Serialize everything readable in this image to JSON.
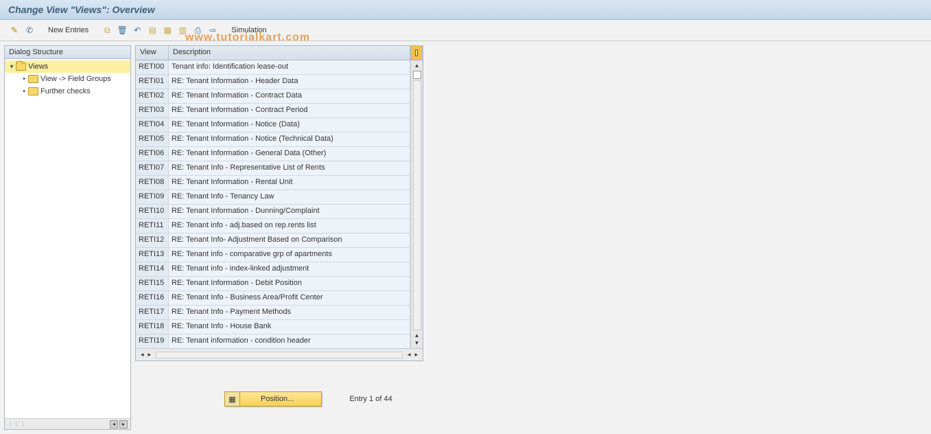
{
  "header": {
    "title": "Change View \"Views\": Overview"
  },
  "toolbar": {
    "new_entries_label": "New Entries",
    "simulation_label": "Simulation"
  },
  "tree": {
    "header": "Dialog Structure",
    "nodes": {
      "views": "Views",
      "field_groups": "View -> Field Groups",
      "further_checks": "Further checks"
    }
  },
  "table": {
    "columns": {
      "view": "View",
      "desc": "Description"
    },
    "rows": [
      {
        "view": "RETI00",
        "desc": "Tenant info: Identification lease-out"
      },
      {
        "view": "RETI01",
        "desc": "RE: Tenant Information - Header Data"
      },
      {
        "view": "RETI02",
        "desc": "RE: Tenant Information - Contract Data"
      },
      {
        "view": "RETI03",
        "desc": "RE: Tenant Information - Contract Period"
      },
      {
        "view": "RETI04",
        "desc": "RE: Tenant Information - Notice (Data)"
      },
      {
        "view": "RETI05",
        "desc": "RE: Tenant Information - Notice (Technical Data)"
      },
      {
        "view": "RETI06",
        "desc": "RE: Tenant Information - General Data (Other)"
      },
      {
        "view": "RETI07",
        "desc": "RE: Tenant Info - Representative List of Rents"
      },
      {
        "view": "RETI08",
        "desc": "RE: Tenant Information - Rental Unit"
      },
      {
        "view": "RETI09",
        "desc": "RE: Tenant Info - Tenancy Law"
      },
      {
        "view": "RETI10",
        "desc": "RE: Tenant Information - Dunning/Complaint"
      },
      {
        "view": "RETI11",
        "desc": "RE: Tenant info - adj.based on rep.rents list"
      },
      {
        "view": "RETI12",
        "desc": "RE: Tenant Info- Adjustment Based on Comparison"
      },
      {
        "view": "RETI13",
        "desc": "RE: Tenant info - comparative grp of apartments"
      },
      {
        "view": "RETI14",
        "desc": "RE: Tenant info - index-linked adjustment"
      },
      {
        "view": "RETI15",
        "desc": "RE: Tenant Information - Debit Position"
      },
      {
        "view": "RETI16",
        "desc": "RE: Tenant Info - Business Area/Profit Center"
      },
      {
        "view": "RETI17",
        "desc": "RE: Tenant Info - Payment Methods"
      },
      {
        "view": "RETI18",
        "desc": "RE: Tenant Info - House Bank"
      },
      {
        "view": "RETI19",
        "desc": "RE: Tenant information - condition header"
      }
    ]
  },
  "footer": {
    "position_label": "Position...",
    "entry_text": "Entry 1 of 44"
  },
  "watermark": "www.tutorialkart.com"
}
